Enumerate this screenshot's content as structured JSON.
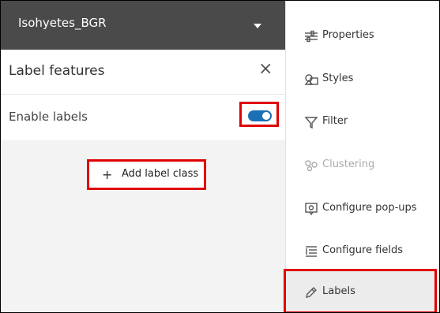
{
  "layer": {
    "name": "Isohyetes_BGR"
  },
  "label_features": {
    "title": "Label features",
    "close_glyph": "×",
    "enable_label": "Enable labels",
    "enable_on": true,
    "add_plus": "+",
    "add_label": "Add label class"
  },
  "sidebar": {
    "items": [
      {
        "label": "Properties",
        "icon": "properties-icon"
      },
      {
        "label": "Styles",
        "icon": "styles-icon"
      },
      {
        "label": "Filter",
        "icon": "filter-icon"
      },
      {
        "label": "Clustering",
        "icon": "clustering-icon",
        "disabled": true
      },
      {
        "label": "Configure pop-ups",
        "icon": "popup-icon"
      },
      {
        "label": "Configure fields",
        "icon": "fields-icon"
      },
      {
        "label": "Labels",
        "icon": "labels-icon",
        "active": true
      }
    ]
  },
  "colors": {
    "highlight": "#e00000",
    "toggle": "#1a6fb5",
    "header_bg": "#4a4a4a"
  }
}
